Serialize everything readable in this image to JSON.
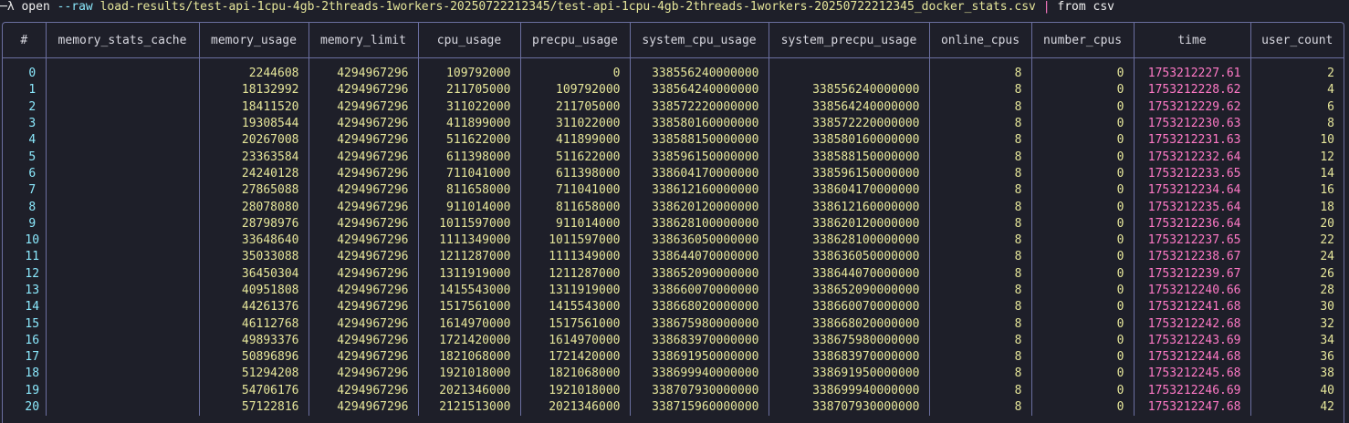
{
  "command": {
    "prompt": "─λ",
    "verb": "open",
    "flag": "--raw",
    "path": "load-results/test-api-1cpu-4gb-2threads-1workers-20250722212345/test-api-1cpu-4gb-2threads-1workers-20250722212345_docker_stats.csv",
    "pipe": "|",
    "tail": "from csv"
  },
  "table": {
    "columns": [
      "#",
      "memory_stats_cache",
      "memory_usage",
      "memory_limit",
      "cpu_usage",
      "precpu_usage",
      "system_cpu_usage",
      "system_precpu_usage",
      "online_cpus",
      "number_cpus",
      "time",
      "user_count"
    ],
    "rows": [
      [
        "0",
        "",
        "2244608",
        "4294967296",
        "109792000",
        "0",
        "338556240000000",
        "",
        "8",
        "0",
        "1753212227.61",
        "2"
      ],
      [
        "1",
        "",
        "18132992",
        "4294967296",
        "211705000",
        "109792000",
        "338564240000000",
        "338556240000000",
        "8",
        "0",
        "1753212228.62",
        "4"
      ],
      [
        "2",
        "",
        "18411520",
        "4294967296",
        "311022000",
        "211705000",
        "338572220000000",
        "338564240000000",
        "8",
        "0",
        "1753212229.62",
        "6"
      ],
      [
        "3",
        "",
        "19308544",
        "4294967296",
        "411899000",
        "311022000",
        "338580160000000",
        "338572220000000",
        "8",
        "0",
        "1753212230.63",
        "8"
      ],
      [
        "4",
        "",
        "20267008",
        "4294967296",
        "511622000",
        "411899000",
        "338588150000000",
        "338580160000000",
        "8",
        "0",
        "1753212231.63",
        "10"
      ],
      [
        "5",
        "",
        "23363584",
        "4294967296",
        "611398000",
        "511622000",
        "338596150000000",
        "338588150000000",
        "8",
        "0",
        "1753212232.64",
        "12"
      ],
      [
        "6",
        "",
        "24240128",
        "4294967296",
        "711041000",
        "611398000",
        "338604170000000",
        "338596150000000",
        "8",
        "0",
        "1753212233.65",
        "14"
      ],
      [
        "7",
        "",
        "27865088",
        "4294967296",
        "811658000",
        "711041000",
        "338612160000000",
        "338604170000000",
        "8",
        "0",
        "1753212234.64",
        "16"
      ],
      [
        "8",
        "",
        "28078080",
        "4294967296",
        "911014000",
        "811658000",
        "338620120000000",
        "338612160000000",
        "8",
        "0",
        "1753212235.64",
        "18"
      ],
      [
        "9",
        "",
        "28798976",
        "4294967296",
        "1011597000",
        "911014000",
        "338628100000000",
        "338620120000000",
        "8",
        "0",
        "1753212236.64",
        "20"
      ],
      [
        "10",
        "",
        "33648640",
        "4294967296",
        "1111349000",
        "1011597000",
        "338636050000000",
        "338628100000000",
        "8",
        "0",
        "1753212237.65",
        "22"
      ],
      [
        "11",
        "",
        "35033088",
        "4294967296",
        "1211287000",
        "1111349000",
        "338644070000000",
        "338636050000000",
        "8",
        "0",
        "1753212238.67",
        "24"
      ],
      [
        "12",
        "",
        "36450304",
        "4294967296",
        "1311919000",
        "1211287000",
        "338652090000000",
        "338644070000000",
        "8",
        "0",
        "1753212239.67",
        "26"
      ],
      [
        "13",
        "",
        "40951808",
        "4294967296",
        "1415543000",
        "1311919000",
        "338660070000000",
        "338652090000000",
        "8",
        "0",
        "1753212240.66",
        "28"
      ],
      [
        "14",
        "",
        "44261376",
        "4294967296",
        "1517561000",
        "1415543000",
        "338668020000000",
        "338660070000000",
        "8",
        "0",
        "1753212241.68",
        "30"
      ],
      [
        "15",
        "",
        "46112768",
        "4294967296",
        "1614970000",
        "1517561000",
        "338675980000000",
        "338668020000000",
        "8",
        "0",
        "1753212242.68",
        "32"
      ],
      [
        "16",
        "",
        "49893376",
        "4294967296",
        "1721420000",
        "1614970000",
        "338683970000000",
        "338675980000000",
        "8",
        "0",
        "1753212243.69",
        "34"
      ],
      [
        "17",
        "",
        "50896896",
        "4294967296",
        "1821068000",
        "1721420000",
        "338691950000000",
        "338683970000000",
        "8",
        "0",
        "1753212244.68",
        "36"
      ],
      [
        "18",
        "",
        "51294208",
        "4294967296",
        "1921018000",
        "1821068000",
        "338699940000000",
        "338691950000000",
        "8",
        "0",
        "1753212245.68",
        "38"
      ],
      [
        "19",
        "",
        "54706176",
        "4294967296",
        "2021346000",
        "1921018000",
        "338707930000000",
        "338699940000000",
        "8",
        "0",
        "1753212246.69",
        "40"
      ],
      [
        "20",
        "",
        "57122816",
        "4294967296",
        "2121513000",
        "2021346000",
        "338715960000000",
        "338707930000000",
        "8",
        "0",
        "1753212247.68",
        "42"
      ]
    ]
  },
  "colors": {
    "background": "#1e1f29",
    "border": "#6b6fa0",
    "index": "#8be9fd",
    "number": "#e6e69a",
    "time": "#ff79c6"
  }
}
